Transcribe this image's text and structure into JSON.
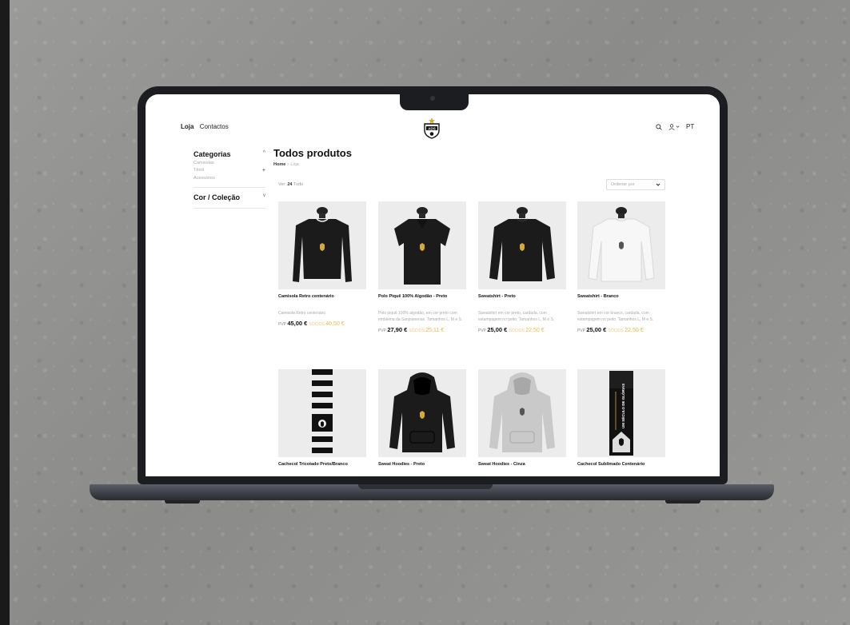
{
  "nav": {
    "shop": "Loja",
    "contacts": "Contactos",
    "language": "PT"
  },
  "logo_text": "ADS",
  "sidebar": {
    "categories_title": "Categorias",
    "categories": [
      {
        "label": "Camisolas",
        "suffix": ""
      },
      {
        "label": "Têxtil",
        "suffix": "+"
      },
      {
        "label": "Acessórios",
        "suffix": ""
      }
    ],
    "collection_title": "Cor / Coleção"
  },
  "main": {
    "title": "Todos produtos",
    "breadcrumb": {
      "home": "Home",
      "sep": "»",
      "current": "Loja"
    },
    "view": {
      "label": "Ver:",
      "option_24": "24",
      "option_all": "Tudo"
    },
    "sort_placeholder": "Ordenar por"
  },
  "price_label": "PVP",
  "socio_label": "SÓCIOS",
  "products": [
    {
      "name": "Camisola Retro centenário",
      "desc": "Camisola Retro centenário",
      "price": "45,00 €",
      "member_price": "40,50 €",
      "color": "black",
      "kind": "longsleeve"
    },
    {
      "name": "Polo Piquê 100% Algodão - Preto",
      "desc": "Polo piquê 100% algodão, em cor preto com emblema da Sanjoanense. Tamanhos L, M e S.",
      "price": "27,90 €",
      "member_price": "25,11 €",
      "color": "black",
      "kind": "polo"
    },
    {
      "name": "Sweatshirt - Preto",
      "desc": "Sweatshirt em cor preto, cardada, com estampagem no peito. Tamanhos L, M e S.",
      "price": "25,00 €",
      "member_price": "22,50 €",
      "color": "black",
      "kind": "sweat"
    },
    {
      "name": "Sweatshirt - Branco",
      "desc": "Sweatshirt em cor branco, cardada, com estampagem no peito. Tamanhos L, M e S.",
      "price": "25,00 €",
      "member_price": "22,50 €",
      "color": "white",
      "kind": "sweat"
    },
    {
      "name": "Cachecol Tricotado Preto/Branco",
      "color": "stripes",
      "kind": "scarf"
    },
    {
      "name": "Sweat Hoodies - Preto",
      "color": "black",
      "kind": "hoodie"
    },
    {
      "name": "Sweat Hoodies - Cinza",
      "color": "gray",
      "kind": "hoodie"
    },
    {
      "name": "Cachecol Sublimado Centenário",
      "scarf_text": "UM SÉCULO DE GLÓRIAS",
      "color": "black",
      "kind": "banner-scarf"
    }
  ]
}
